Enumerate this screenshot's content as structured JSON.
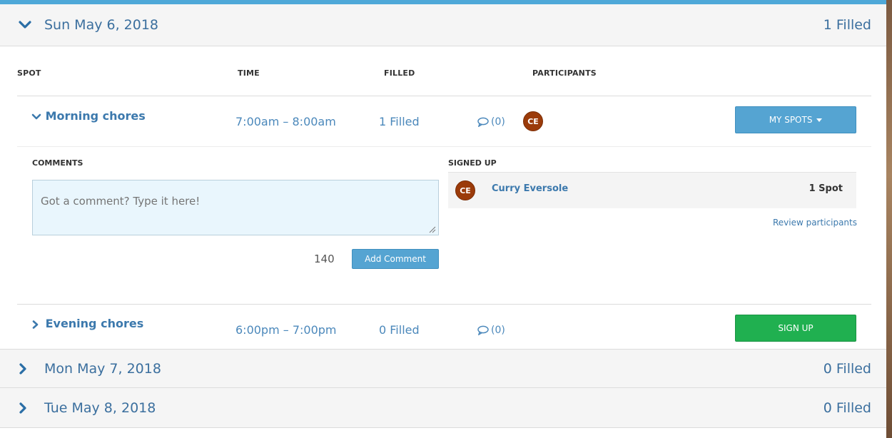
{
  "dates": [
    {
      "label": "Sun May 6, 2018",
      "filled": "1 Filled",
      "expanded": true
    },
    {
      "label": "Mon May 7, 2018",
      "filled": "0 Filled",
      "expanded": false
    },
    {
      "label": "Tue May 8, 2018",
      "filled": "0 Filled",
      "expanded": false
    }
  ],
  "table": {
    "headers": {
      "spot": "SPOT",
      "time": "TIME",
      "filled": "FILLED",
      "participants": "PARTICIPANTS"
    }
  },
  "spots": [
    {
      "name": "Morning chores",
      "time": "7:00am – 8:00am",
      "filled": "1 Filled",
      "comments": "(0)",
      "avatar_initials": "CE",
      "action_label": "MY SPOTS"
    },
    {
      "name": "Evening chores",
      "time": "6:00pm – 7:00pm",
      "filled": "0 Filled",
      "comments": "(0)",
      "action_label": "SIGN UP"
    }
  ],
  "details": {
    "comments_label": "COMMENTS",
    "comment_placeholder": "Got a comment? Type it here!",
    "char_count": "140",
    "add_comment_label": "Add Comment",
    "signed_up_label": "SIGNED UP",
    "participant": {
      "initials": "CE",
      "name": "Curry Eversole",
      "spots": "1 Spot"
    },
    "review_link": "Review participants"
  },
  "colors": {
    "accent": "#55a4d2",
    "signup": "#20b050",
    "avatar": "#9b3b0a",
    "link": "#3c79ad"
  },
  "icons": [
    "chevron-down-icon",
    "chevron-right-icon",
    "comment-icon",
    "caret-down-icon",
    "resize-grip-icon"
  ]
}
